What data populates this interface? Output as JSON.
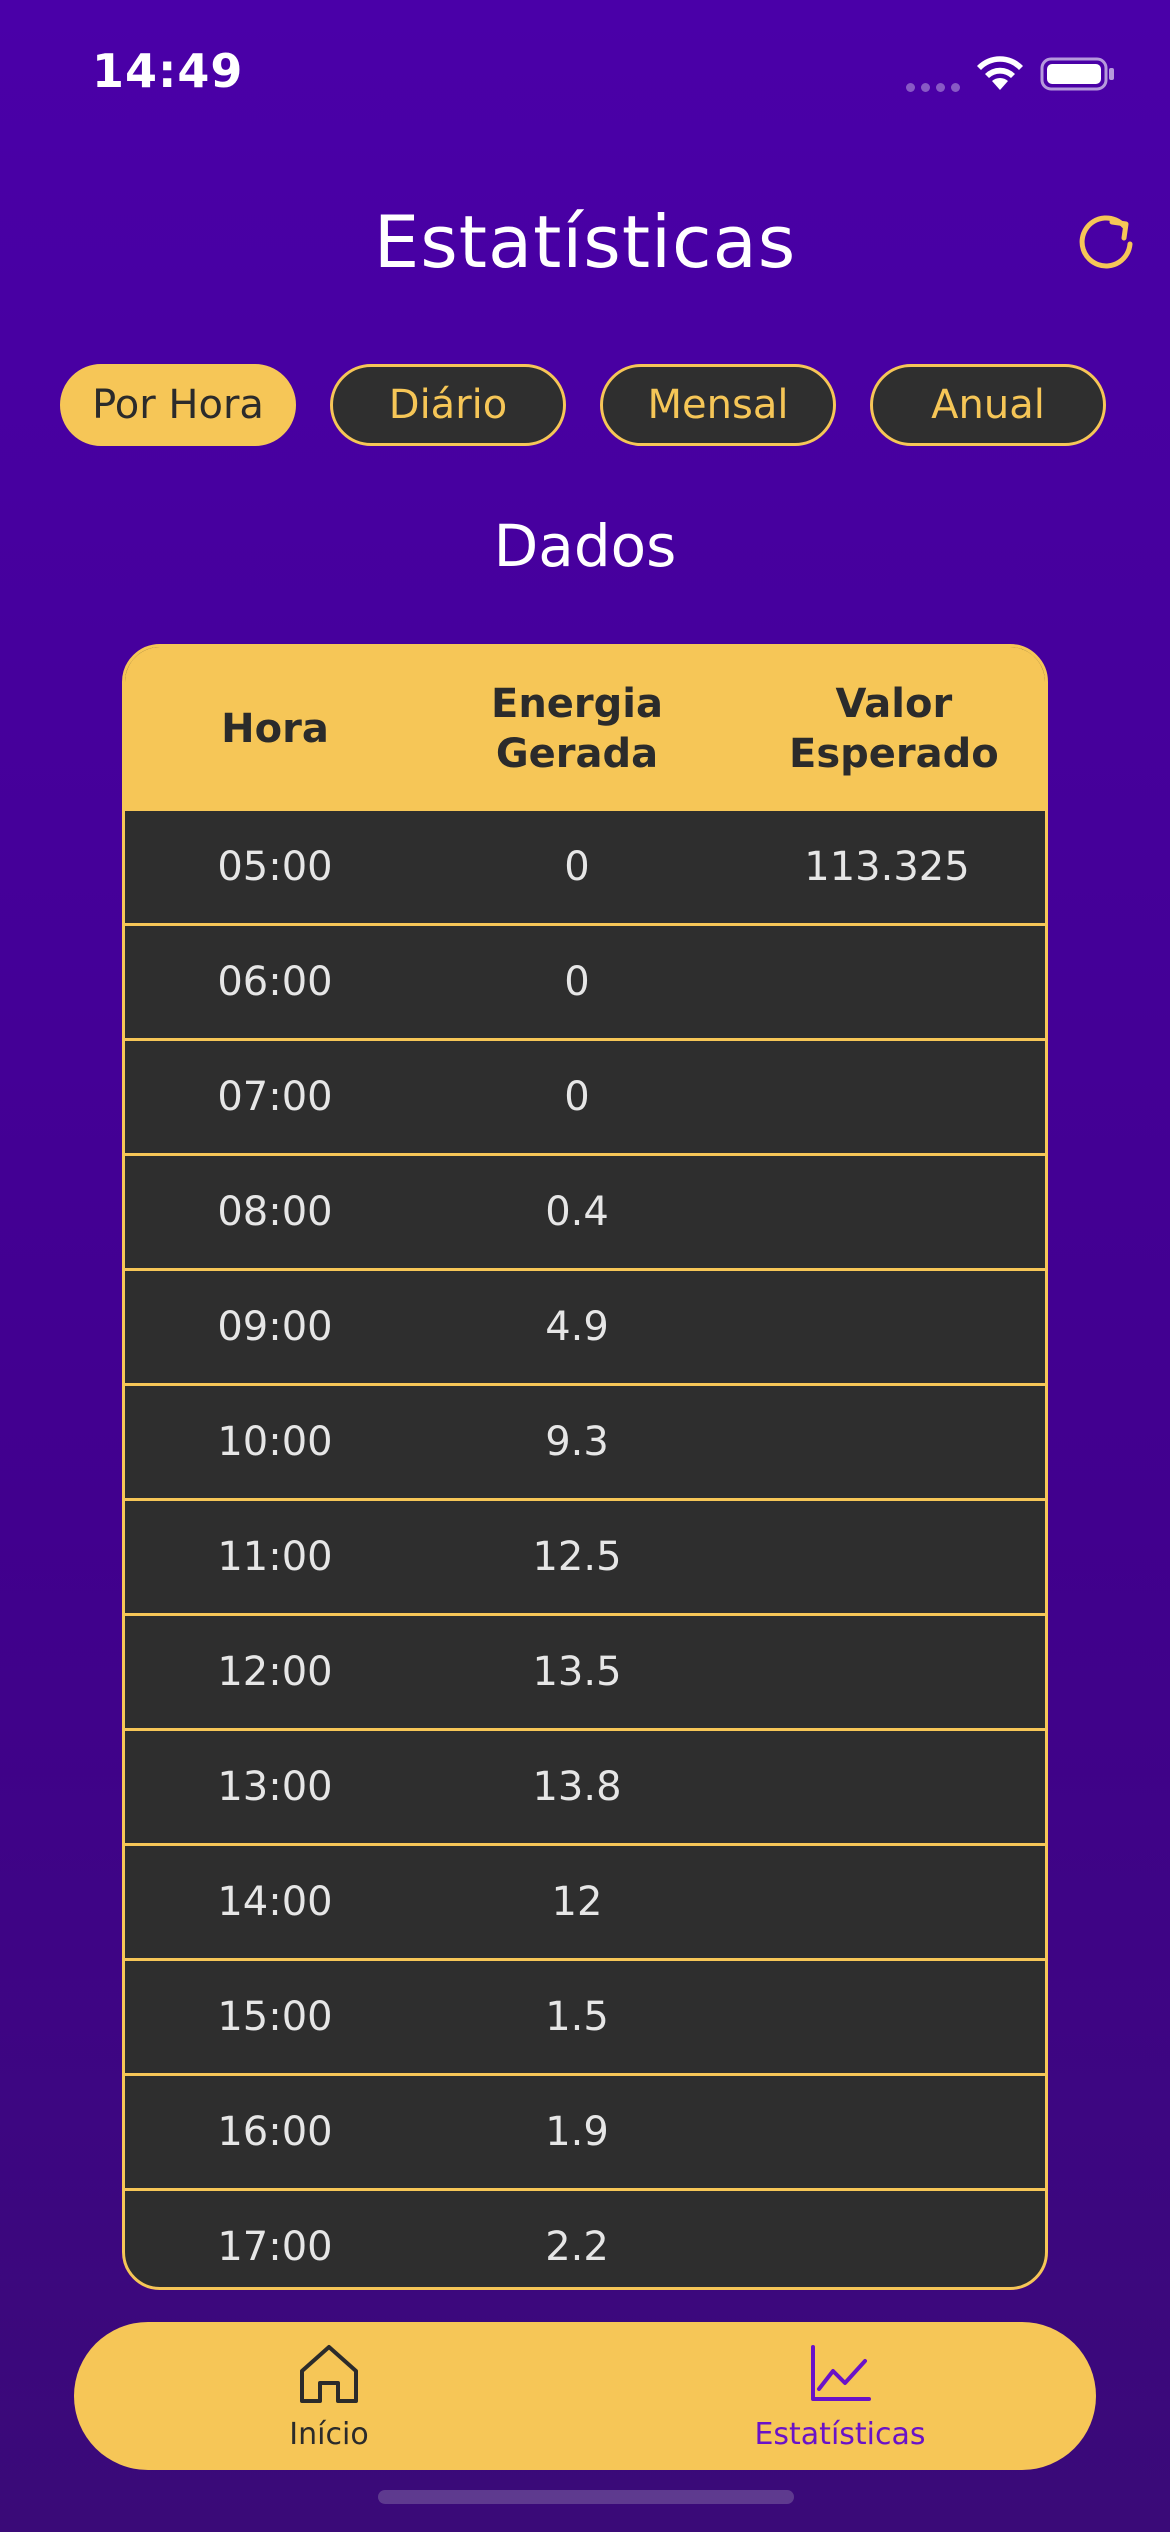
{
  "status_bar": {
    "time": "14:49"
  },
  "header": {
    "title": "Estatísticas",
    "refresh_icon": "refresh-icon"
  },
  "tabs": [
    {
      "label": "Por Hora",
      "active": true
    },
    {
      "label": "Diário",
      "active": false
    },
    {
      "label": "Mensal",
      "active": false
    },
    {
      "label": "Anual",
      "active": false
    }
  ],
  "section": {
    "title": "Dados"
  },
  "table": {
    "columns": [
      "Hora",
      "Energia Gerada",
      "Valor Esperado"
    ],
    "rows": [
      [
        "05:00",
        "0",
        "113.325"
      ],
      [
        "06:00",
        "0",
        ""
      ],
      [
        "07:00",
        "0",
        ""
      ],
      [
        "08:00",
        "0.4",
        ""
      ],
      [
        "09:00",
        "4.9",
        ""
      ],
      [
        "10:00",
        "9.3",
        ""
      ],
      [
        "11:00",
        "12.5",
        ""
      ],
      [
        "12:00",
        "13.5",
        ""
      ],
      [
        "13:00",
        "13.8",
        ""
      ],
      [
        "14:00",
        "12",
        ""
      ],
      [
        "15:00",
        "1.5",
        ""
      ],
      [
        "16:00",
        "1.9",
        ""
      ],
      [
        "17:00",
        "2.2",
        ""
      ]
    ]
  },
  "bottom_nav": {
    "items": [
      {
        "label": "Início",
        "icon": "home-icon",
        "active": false
      },
      {
        "label": "Estatísticas",
        "icon": "chart-line-icon",
        "active": true
      }
    ]
  },
  "colors": {
    "background": "#4a00a8",
    "accent": "#f6c657",
    "row_bg": "#2e2e2e",
    "active_nav": "#6a12c8"
  }
}
